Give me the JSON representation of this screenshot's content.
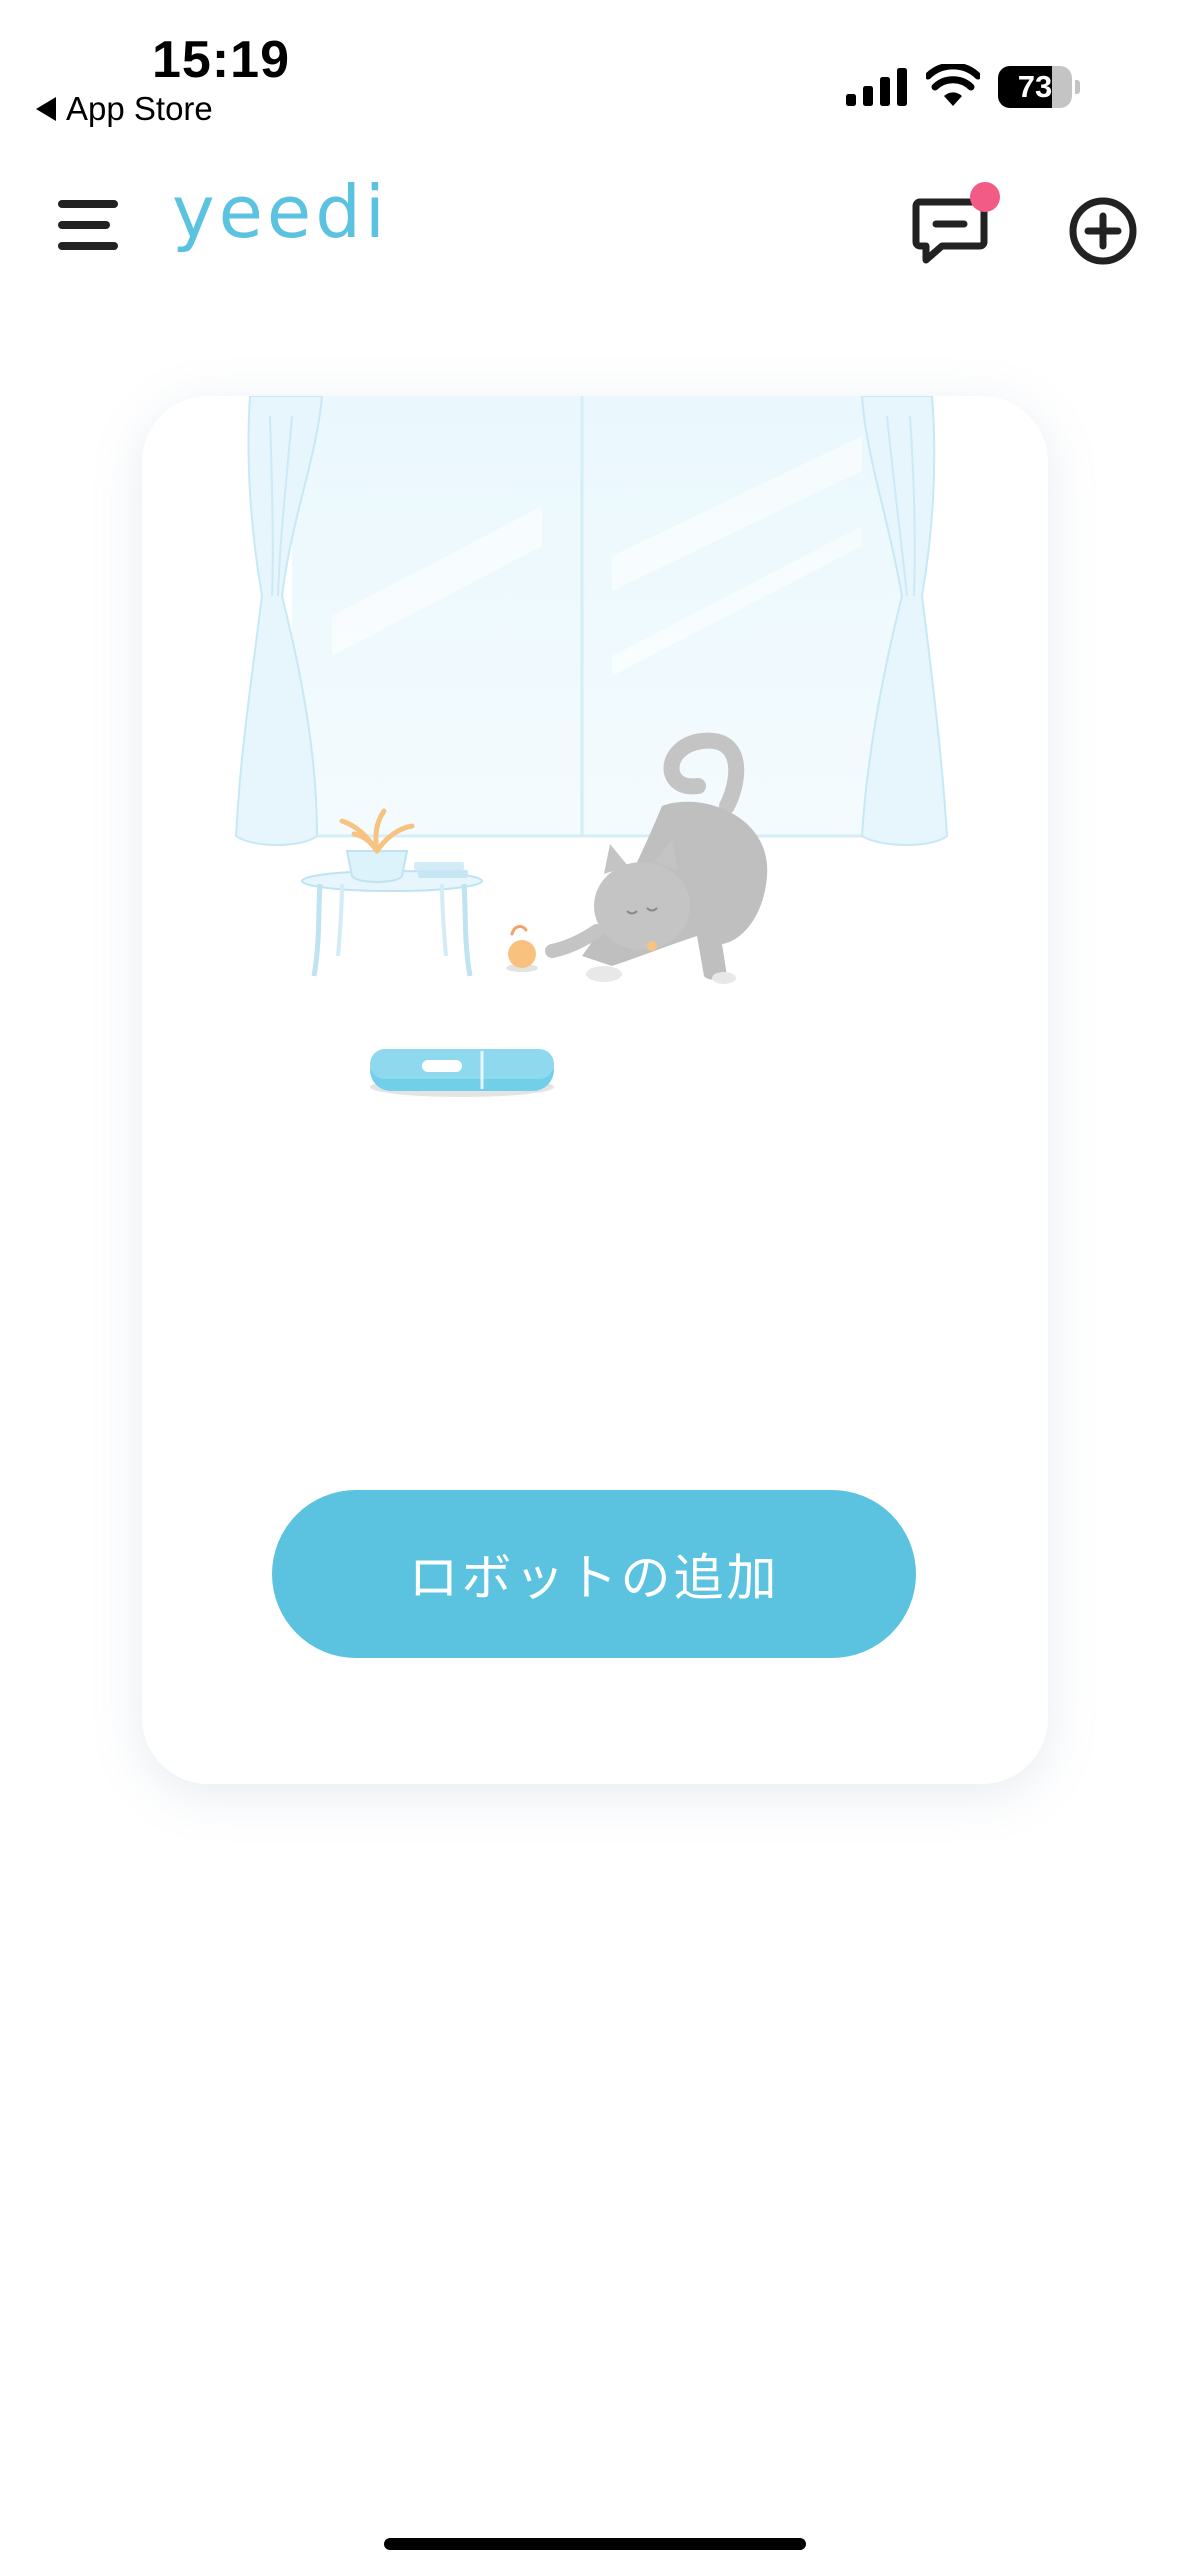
{
  "status_bar": {
    "time": "15:19",
    "back_label": "App Store",
    "battery_percent": 73,
    "battery_label": "73"
  },
  "header": {
    "logo": "yeedi",
    "notification_dot": true
  },
  "card": {
    "add_robot_label": "ロボットの追加"
  },
  "colors": {
    "brand": "#5bc2e0",
    "notification": "#f25b86",
    "background": "#ffffff"
  },
  "icons": {
    "menu": "hamburger-menu-icon",
    "messages": "message-icon",
    "add": "plus-circle-icon"
  }
}
